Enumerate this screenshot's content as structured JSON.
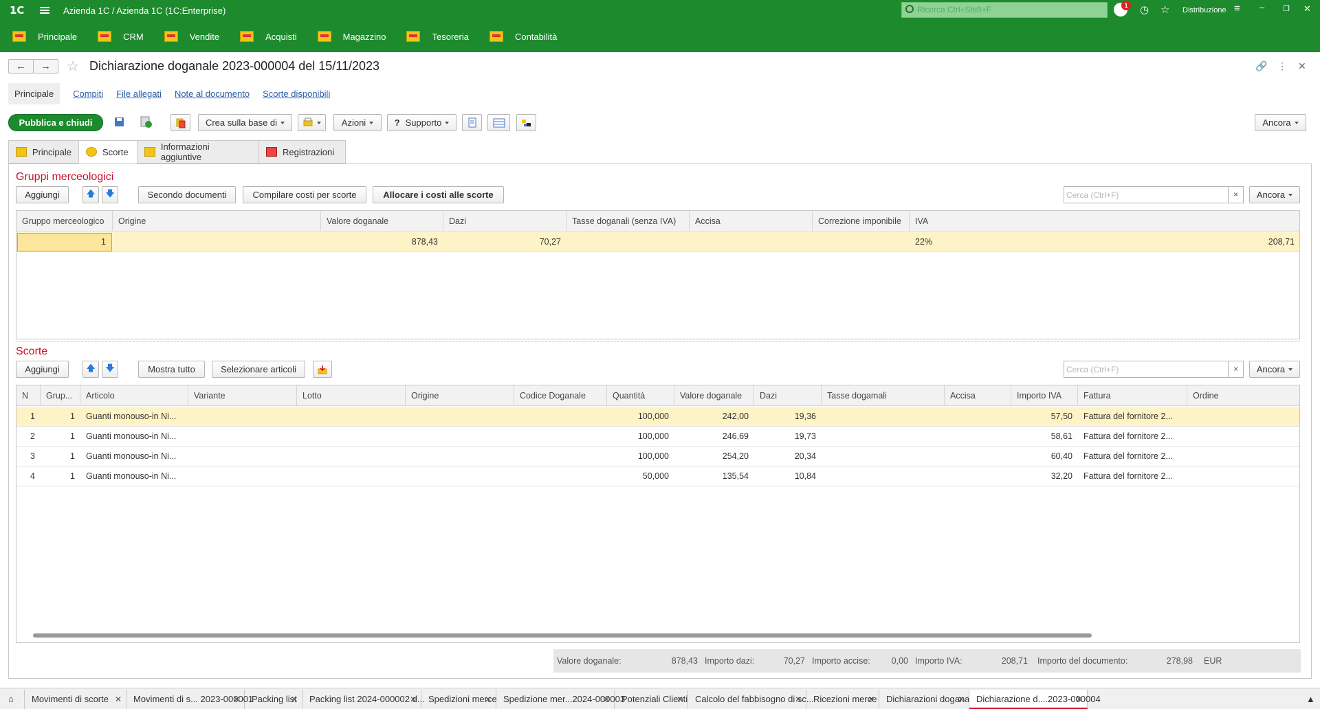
{
  "app": {
    "logo": "1C",
    "title": "Azienda 1C / Azienda 1C  (1C:Enterprise)",
    "search_placeholder": "Ricerca Ctrl+Shift+F",
    "notifications": "1",
    "user": "Distribuzione"
  },
  "nav": [
    {
      "label": "Principale"
    },
    {
      "label": "CRM"
    },
    {
      "label": "Vendite"
    },
    {
      "label": "Acquisti"
    },
    {
      "label": "Magazzino"
    },
    {
      "label": "Tesoreria"
    },
    {
      "label": "Contabilità"
    }
  ],
  "document": {
    "title": "Dichiarazione doganale 2023-000004 del 15/11/2023"
  },
  "links": [
    {
      "label": "Principale"
    },
    {
      "label": "Compiti"
    },
    {
      "label": "File allegati"
    },
    {
      "label": "Note al documento"
    },
    {
      "label": "Scorte disponibili"
    }
  ],
  "toolbar": {
    "publish": "Pubblica e chiudi",
    "create_based": "Crea sulla base di",
    "actions": "Azioni",
    "support": "Supporto",
    "more": "Ancora"
  },
  "tabs": [
    {
      "label": "Principale"
    },
    {
      "label": "Scorte"
    },
    {
      "label": "Informazioni aggiuntive"
    },
    {
      "label": "Registrazioni"
    }
  ],
  "groups": {
    "title": "Gruppi merceologici",
    "buttons": {
      "add": "Aggiungi",
      "by_docs": "Secondo documenti",
      "fill_costs": "Compilare costi per scorte",
      "allocate": "Allocare i costi alle scorte",
      "more": "Ancora"
    },
    "search_placeholder": "Cerca (Ctrl+F)",
    "columns": [
      "Gruppo merceologico",
      "Origine",
      "Valore doganale",
      "Dazi",
      "Tasse doganali (senza IVA)",
      "Accisa",
      "Correzione imponibile",
      "IVA"
    ],
    "rows": [
      {
        "group": "1",
        "origin": "",
        "value": "878,43",
        "duties": "70,27",
        "taxes": "",
        "excise": "",
        "correction": "",
        "vat": "22%",
        "vat_amount": "208,71"
      }
    ]
  },
  "stock": {
    "title": "Scorte",
    "buttons": {
      "add": "Aggiungi",
      "show_all": "Mostra tutto",
      "select_items": "Selezionare articoli",
      "more": "Ancora"
    },
    "search_placeholder": "Cerca (Ctrl+F)",
    "columns": [
      "N",
      "Grup...",
      "Articolo",
      "Variante",
      "Lotto",
      "Origine",
      "Codice Doganale",
      "Quantità",
      "Valore doganale",
      "Dazi",
      "Tasse dogamali",
      "Accisa",
      "Importo IVA",
      "Fattura",
      "Ordine"
    ],
    "rows": [
      {
        "n": "1",
        "group": "1",
        "item": "Guanti monouso-in Ni...",
        "qty": "100,000",
        "value": "242,00",
        "duties": "19,36",
        "vat": "57,50",
        "invoice": "Fattura del fornitore 2..."
      },
      {
        "n": "2",
        "group": "1",
        "item": "Guanti monouso-in Ni...",
        "qty": "100,000",
        "value": "246,69",
        "duties": "19,73",
        "vat": "58,61",
        "invoice": "Fattura del fornitore 2..."
      },
      {
        "n": "3",
        "group": "1",
        "item": "Guanti monouso-in Ni...",
        "qty": "100,000",
        "value": "254,20",
        "duties": "20,34",
        "vat": "60,40",
        "invoice": "Fattura del fornitore 2..."
      },
      {
        "n": "4",
        "group": "1",
        "item": "Guanti monouso-in Ni...",
        "qty": "50,000",
        "value": "135,54",
        "duties": "10,84",
        "vat": "32,20",
        "invoice": "Fattura del fornitore 2..."
      }
    ]
  },
  "totals": {
    "customs_value_label": "Valore doganale:",
    "customs_value": "878,43",
    "duties_label": "Importo dazi:",
    "duties": "70,27",
    "excise_label": "Importo accise:",
    "excise": "0,00",
    "vat_label": "Importo IVA:",
    "vat": "208,71",
    "doc_label": "Importo del documento:",
    "doc": "278,98",
    "currency": "EUR"
  },
  "open_windows": [
    {
      "label": "Movimenti di scorte"
    },
    {
      "label": "Movimenti di s... 2023-000001"
    },
    {
      "label": "Packing list"
    },
    {
      "label": "Packing list 2024-000002 d..."
    },
    {
      "label": "Spedizioni merce"
    },
    {
      "label": "Spedizione mer...2024-000003"
    },
    {
      "label": "Potenziali Clienti"
    },
    {
      "label": "Calcolo del fabbisogno di sc..."
    },
    {
      "label": "Ricezioni merce"
    },
    {
      "label": "Dichiarazioni doganali"
    },
    {
      "label": "Dichiarazione d....2023-000004"
    }
  ]
}
